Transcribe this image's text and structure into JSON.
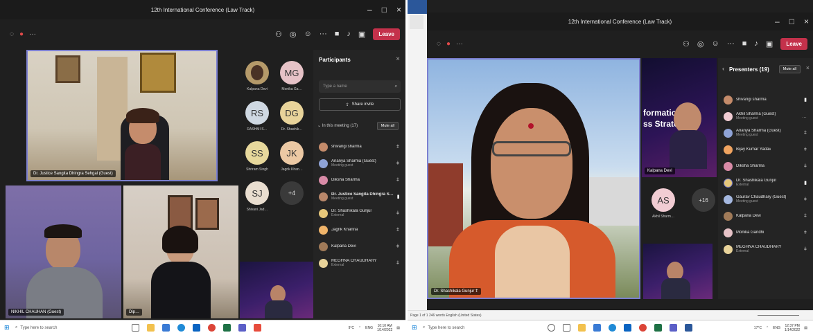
{
  "left": {
    "title": "12th International Conference (Law Track)",
    "leave_label": "Leave",
    "main_tile_name": "Dr. Justice Sangita Dhingra Sehgal (Guest)",
    "tile2_name": "NIKHIL CHAUHAN (Guest)",
    "tile3_name": "Dip…",
    "avatars": [
      {
        "initials": "",
        "name": "Kalpana Devi"
      },
      {
        "initials": "MG",
        "name": "Monika Ga…"
      },
      {
        "initials": "RS",
        "name": "RASHMI S…"
      },
      {
        "initials": "DG",
        "name": "Dr. Shashik…"
      },
      {
        "initials": "SS",
        "name": "Shriram Singh"
      },
      {
        "initials": "JK",
        "name": "Jagrik Khan…"
      },
      {
        "initials": "SJ",
        "name": "Shivani Jad…"
      },
      {
        "initials": "+4",
        "name": ""
      }
    ],
    "participants": {
      "title": "Participants",
      "search_placeholder": "Type a name",
      "share_invite": "Share invite",
      "section": "In this meeting (17)",
      "mute_all": "Mute all",
      "rows": [
        {
          "name": "shivangi sharma",
          "sub": ""
        },
        {
          "name": "Ananya Sharma (Guest)",
          "sub": "Meeting guest"
        },
        {
          "name": "Diksha Sharma",
          "sub": ""
        },
        {
          "name": "Dr. Justice Sangita Dhingra S…",
          "sub": "Meeting guest"
        },
        {
          "name": "Dr. Shashikala Gunjur",
          "sub": "External"
        },
        {
          "name": "Jagrik Khanna",
          "sub": ""
        },
        {
          "name": "Kalpana Devi",
          "sub": ""
        },
        {
          "name": "MEGHNA CHAUDHARY",
          "sub": "External"
        }
      ]
    },
    "taskbar": {
      "search": "Type here to search",
      "temp": "9°C",
      "lang": "ENG",
      "time": "10:10 AM",
      "date": "1/14/2022"
    }
  },
  "right": {
    "title": "12th International Conference (Law Track)",
    "leave_label": "Leave",
    "speaker_name": "Dr. Shashikala Gunjur",
    "slide_text_1": "formation",
    "slide_text_2": "ss Strategie",
    "slide_person": "Kalpana Devi",
    "av_initials": "AS",
    "av_name": "Akhil Sharm…",
    "av_more": "+16",
    "presenters": {
      "title": "Presenters (19)",
      "mute_all": "Mute all",
      "rows": [
        {
          "name": "shivangi sharma",
          "sub": ""
        },
        {
          "name": "Akhil Sharma (Guest)",
          "sub": "Meeting guest"
        },
        {
          "name": "Ananya Sharma (Guest)",
          "sub": "Meeting guest"
        },
        {
          "name": "Bijay Kumar Yadav",
          "sub": ""
        },
        {
          "name": "Diksha Sharma",
          "sub": ""
        },
        {
          "name": "Dr. Shashikala Gunjur",
          "sub": "External"
        },
        {
          "name": "Gaurav Chaudhary (Guest)",
          "sub": "Meeting guest"
        },
        {
          "name": "Kalpana Devi",
          "sub": ""
        },
        {
          "name": "Monika Gandhi",
          "sub": ""
        },
        {
          "name": "MEGHNA CHAUDHARY",
          "sub": "External"
        }
      ]
    },
    "status": "Page 1 of 1   246 words   English (United States)",
    "taskbar": {
      "search": "Type here to search",
      "temp": "17°C",
      "lang": "ENG",
      "time": "12:37 PM",
      "date": "1/14/2022"
    }
  },
  "colors": {
    "accent": "#6264a7",
    "leave": "#c4314b"
  }
}
